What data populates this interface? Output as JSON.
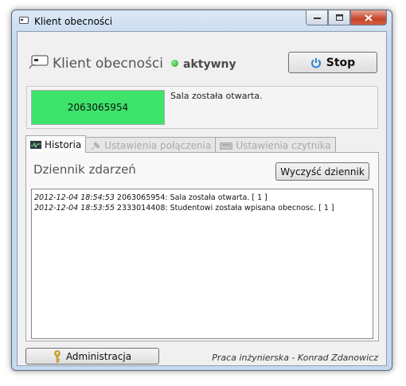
{
  "window": {
    "title": "Klient obecności",
    "icons": {
      "app": "card-reader-icon",
      "minimize": "minimize-icon",
      "maximize": "maximize-icon",
      "close": "close-icon"
    }
  },
  "status": {
    "title": "Klient obecności",
    "state": "aktywny",
    "state_color": "#1ba51b",
    "stop_label": "Stop",
    "stop_icon": "power-icon"
  },
  "card": {
    "id": "2063065954",
    "message": "Sala została otwarta.",
    "id_background": "#3de36a"
  },
  "tabs": [
    {
      "label": "Historia",
      "icon": "chart-icon",
      "active": true
    },
    {
      "label": "Ustawienia połączenia",
      "icon": "plug-icon",
      "active": false
    },
    {
      "label": "Ustawienia czytnika",
      "icon": "reader-icon",
      "active": false
    }
  ],
  "log": {
    "title": "Dziennik zdarzeń",
    "clear_label": "Wyczyść dziennik",
    "entries": [
      {
        "timestamp": "2012-12-04 18:54:53",
        "text": " 2063065954: Sala została otwarta. [ 1 ]"
      },
      {
        "timestamp": "2012-12-04 18:53:55",
        "text": " 2333014408: Studentowi została wpisana obecnosc. [ 1 ]"
      }
    ]
  },
  "footer": {
    "admin_label": "Administracja",
    "admin_icon": "key-icon",
    "credit": "Praca inżynierska - Konrad Zdanowicz"
  }
}
